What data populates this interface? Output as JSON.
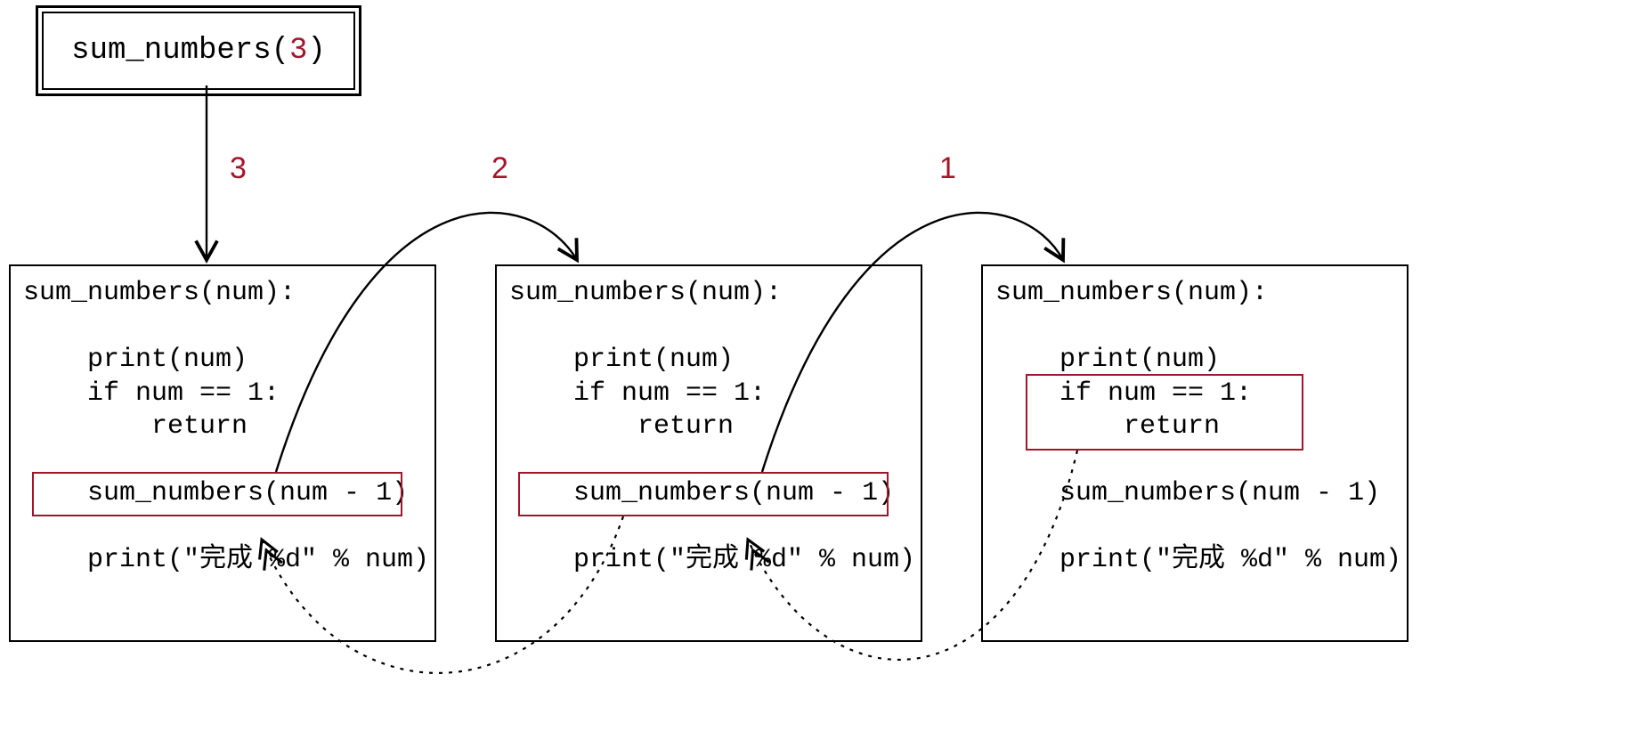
{
  "initial_call": {
    "func": "sum_numbers",
    "arg": "3"
  },
  "edge_labels": {
    "e1": "3",
    "e2": "2",
    "e3": "1"
  },
  "code": {
    "header": "sum_numbers(num):",
    "print_line": "    print(num)",
    "if_line": "    if num == 1:",
    "return_line": "        return",
    "recurse_line": "    sum_numbers(num - 1)",
    "print_done": "    print(\"完成 %d\" % num)"
  },
  "colors": {
    "highlight": "#a3152a"
  }
}
